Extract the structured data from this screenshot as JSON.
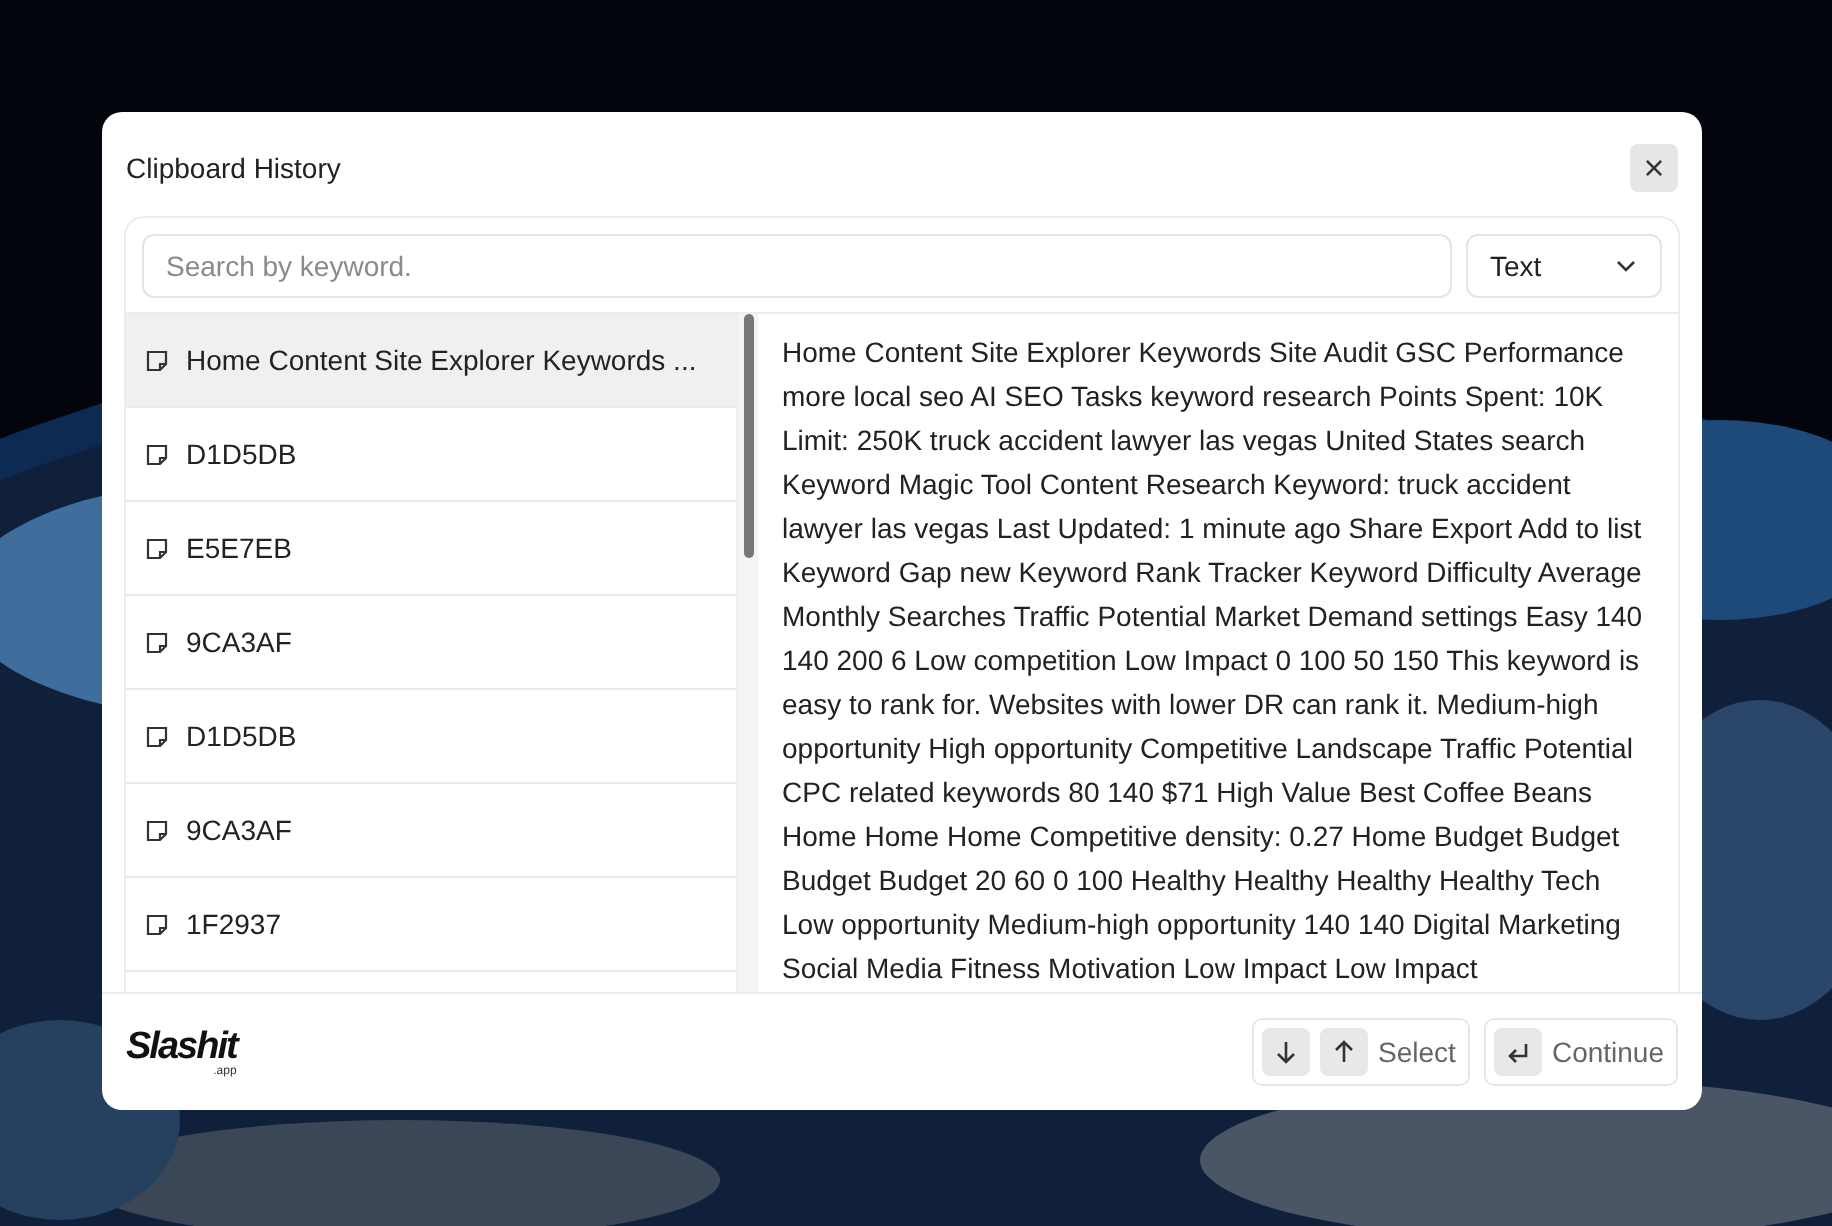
{
  "window": {
    "title": "Clipboard History",
    "close": "×"
  },
  "search": {
    "placeholder": "Search by keyword."
  },
  "filter": {
    "value": "Text"
  },
  "items": [
    {
      "label": "Home Content Site Explorer Keywords ...",
      "selected": true
    },
    {
      "label": "D1D5DB",
      "selected": false
    },
    {
      "label": "E5E7EB",
      "selected": false
    },
    {
      "label": "9CA3AF",
      "selected": false
    },
    {
      "label": "D1D5DB",
      "selected": false
    },
    {
      "label": "9CA3AF",
      "selected": false
    },
    {
      "label": "1F2937",
      "selected": false
    }
  ],
  "preview": "Home Content Site Explorer Keywords Site Audit GSC Performance more local seo AI SEO Tasks keyword research Points Spent: 10K Limit: 250K truck accident lawyer las vegas United States search Keyword Magic Tool Content Research Keyword: truck accident lawyer las vegas Last Updated: 1 minute ago Share Export Add to list Keyword Gap new Keyword Rank Tracker Keyword Difficulty Average Monthly Searches Traffic Potential Market Demand settings Easy 140 140 200 6 Low competition Low Impact 0 100 50 150 This keyword is easy to rank for. Websites with lower DR can rank it. Medium-high opportunity High opportunity Competitive Landscape Traffic Potential CPC related keywords 80 140 $71 High Value Best Coffee Beans Home Home Home Competitive density: 0.27 Home Budget Budget Budget Budget 20 60 0 100 Healthy Healthy Healthy Healthy Tech Low opportunity Medium-high opportunity 140 140 Digital Marketing Social Media Fitness Motivation Low Impact Low Impact",
  "footer": {
    "logo": "Slashit",
    "logo_suffix": ".app",
    "select_label": "Select",
    "continue_label": "Continue"
  }
}
